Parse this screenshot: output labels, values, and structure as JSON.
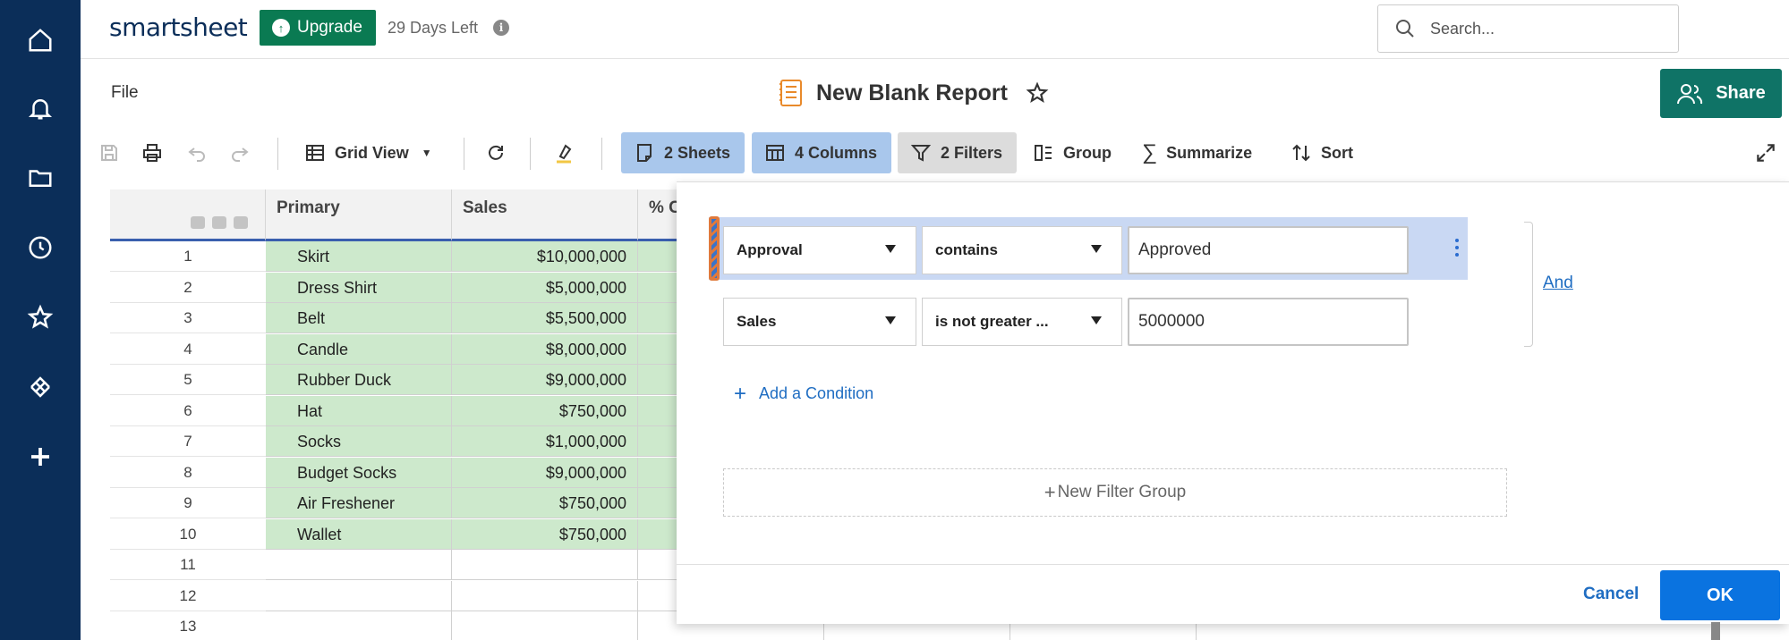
{
  "topbar": {
    "logo": "smartsheet",
    "upgrade_label": "Upgrade",
    "days_left": "29 Days Left",
    "search_placeholder": "Search..."
  },
  "title_row": {
    "file_menu": "File",
    "report_title": "New Blank Report",
    "share_label": "Share"
  },
  "toolbar": {
    "grid_view": "Grid View",
    "sheets": "2 Sheets",
    "columns": "4 Columns",
    "filters": "2 Filters",
    "group": "Group",
    "summarize": "Summarize",
    "sort": "Sort"
  },
  "grid": {
    "columns": [
      "Primary",
      "Sales",
      "% C"
    ],
    "row_numbers": [
      "1",
      "2",
      "3",
      "4",
      "5",
      "6",
      "7",
      "8",
      "9",
      "10",
      "11",
      "12",
      "13"
    ],
    "rows": [
      {
        "primary": "Skirt",
        "sales": "$10,000,000"
      },
      {
        "primary": "Dress Shirt",
        "sales": "$5,000,000"
      },
      {
        "primary": "Belt",
        "sales": "$5,500,000"
      },
      {
        "primary": "Candle",
        "sales": "$8,000,000"
      },
      {
        "primary": "Rubber Duck",
        "sales": "$9,000,000"
      },
      {
        "primary": "Hat",
        "sales": "$750,000"
      },
      {
        "primary": "Socks",
        "sales": "$1,000,000"
      },
      {
        "primary": "Budget Socks",
        "sales": "$9,000,000"
      },
      {
        "primary": "Air Freshener",
        "sales": "$750,000"
      },
      {
        "primary": "Wallet",
        "sales": "$750,000"
      }
    ]
  },
  "filter": {
    "conditions": [
      {
        "field": "Approval",
        "operator": "contains",
        "value": "Approved"
      },
      {
        "field": "Sales",
        "operator": "is not greater ...",
        "value": "5000000"
      }
    ],
    "logic": "And",
    "add_condition": "Add a Condition",
    "new_filter_group": "New Filter Group",
    "cancel_label": "Cancel",
    "ok_label": "OK"
  },
  "colors": {
    "nav_bg": "#0b2e59",
    "upgrade_bg": "#0a7a52",
    "share_bg": "#0f7366",
    "row_green": "#cde9cc",
    "ok_blue": "#0a73e0",
    "link_blue": "#1f6dc2"
  }
}
